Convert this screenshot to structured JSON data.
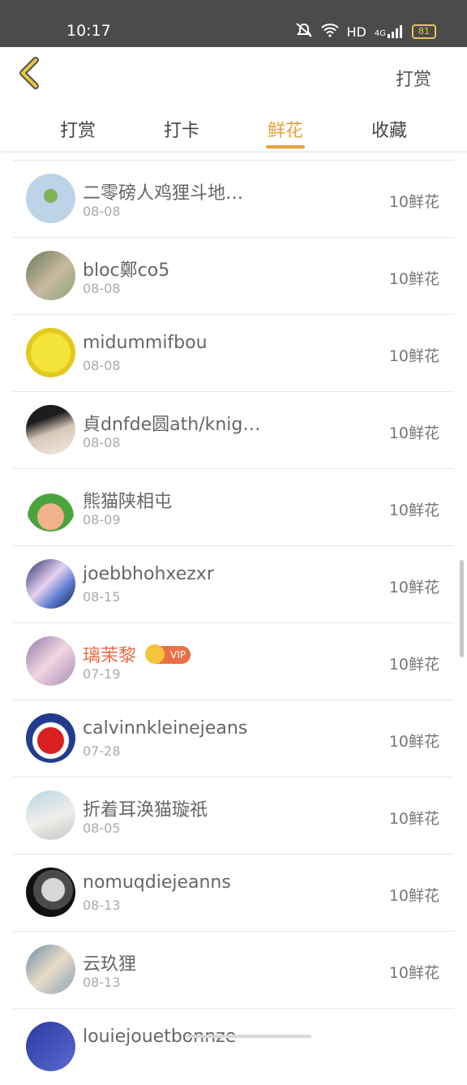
{
  "status_bar": {
    "time": "10:17",
    "network": "HD",
    "signal": "4G",
    "battery": "81"
  },
  "header": {
    "right_label": "打赏"
  },
  "tabs": [
    {
      "label": "打赏",
      "active": false
    },
    {
      "label": "打卡",
      "active": false
    },
    {
      "label": "鲜花",
      "active": true
    },
    {
      "label": "收藏",
      "active": false
    }
  ],
  "colors": {
    "accent": "#e7a23b",
    "vip": "#e86f46",
    "statusbar": "#4b4b4b"
  },
  "rows": [
    {
      "name": "二零磅人鸡狸斗地…",
      "date": "08-08",
      "amount": "10鲜花"
    },
    {
      "name": "bloc鄭co5",
      "date": "08-08",
      "amount": "10鲜花"
    },
    {
      "name": "midummifbou",
      "date": "08-08",
      "amount": "10鲜花"
    },
    {
      "name": "貞dnfde圆ath/knig…",
      "date": "08-08",
      "amount": "10鲜花"
    },
    {
      "name": "熊猫陕相屯",
      "date": "08-09",
      "amount": "10鲜花"
    },
    {
      "name": "joebbhohxezxr",
      "date": "08-15",
      "amount": "10鲜花"
    },
    {
      "name": "璃茉黎",
      "date": "07-19",
      "amount": "10鲜花",
      "vip": "VIP"
    },
    {
      "name": "calvinnkleinejeans",
      "date": "07-28",
      "amount": "10鲜花"
    },
    {
      "name": "折着耳涣猫璇祇",
      "date": "08-05",
      "amount": "10鲜花"
    },
    {
      "name": "nomuqdiejeanns",
      "date": "08-13",
      "amount": "10鲜花"
    },
    {
      "name": "云玖狸",
      "date": "08-13",
      "amount": "10鲜花"
    },
    {
      "name": "louiejouetbonnze",
      "date": "",
      "amount": ""
    }
  ]
}
